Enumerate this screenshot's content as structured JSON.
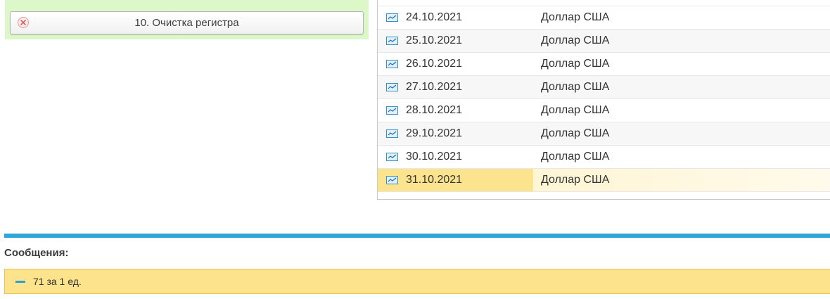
{
  "command_panel": {
    "clear_register_button": "10. Очистка регистра"
  },
  "table": {
    "rows": [
      {
        "date": "24.10.2021",
        "currency": "Доллар США"
      },
      {
        "date": "25.10.2021",
        "currency": "Доллар США"
      },
      {
        "date": "26.10.2021",
        "currency": "Доллар США"
      },
      {
        "date": "27.10.2021",
        "currency": "Доллар США"
      },
      {
        "date": "28.10.2021",
        "currency": "Доллар США"
      },
      {
        "date": "29.10.2021",
        "currency": "Доллар США"
      },
      {
        "date": "30.10.2021",
        "currency": "Доллар США"
      },
      {
        "date": "31.10.2021",
        "currency": "Доллар США"
      }
    ],
    "selected_row_index": 7,
    "row_icon": "chart-record-icon"
  },
  "messages": {
    "title": "Сообщения:",
    "items": [
      {
        "text": "71 за 1 ед."
      }
    ]
  },
  "colors": {
    "panel_green": "#dcf7c8",
    "splitter_blue": "#2fa6d6",
    "message_yellow": "#fde38b",
    "selection_yellow": "#fce48e"
  }
}
